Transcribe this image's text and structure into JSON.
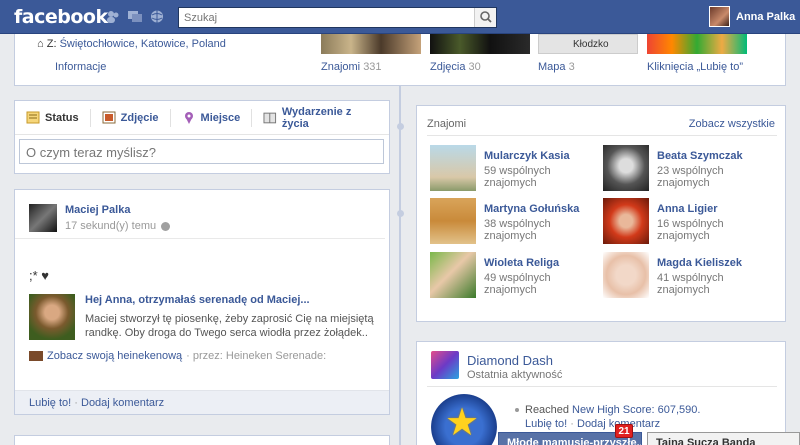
{
  "topbar": {
    "logo": "facebook",
    "search_placeholder": "Szukaj",
    "user_name": "Anna Palka"
  },
  "about": {
    "location_prefix": "Z:",
    "location": "Świętochłowice, Katowice, Poland",
    "info_label": "Informacje",
    "map_caption": "Kłodzko",
    "sections": [
      {
        "label": "Znajomi",
        "count": "331"
      },
      {
        "label": "Zdjęcia",
        "count": "30"
      },
      {
        "label": "Mapa",
        "count": "3"
      },
      {
        "label": "Kliknięcia „Lubię to”",
        "count": ""
      }
    ]
  },
  "composer": {
    "tabs": [
      "Status",
      "Zdjęcie",
      "Miejsce",
      "Wydarzenie z życia"
    ],
    "placeholder": "O czym teraz myślisz?"
  },
  "post": {
    "author": "Maciej Palka",
    "time": "17 sekund(y) temu",
    "message": ";* ♥",
    "attachment_title": "Hej Anna, otrzymałaś serenadę od Maciej...",
    "attachment_desc": "Maciej stworzył tę piosenkę, żeby zaprosić Cię na miejsiętą randkę. Oby droga do Twego serca wiodła przez żołądek..",
    "via_link": "Zobacz swoją heinekenową",
    "via_rest": "· przez: Heineken Serenade:",
    "like": "Lubię to!",
    "comment": "Dodaj komentarz"
  },
  "friends": {
    "title": "Znajomi",
    "see_all": "Zobacz wszystkie",
    "list": [
      {
        "name": "Mularczyk Kasia",
        "mutual": "59 wspólnych znajomych"
      },
      {
        "name": "Beata Szymczak",
        "mutual": "23 wspólnych znajomych"
      },
      {
        "name": "Martyna Gołuńska",
        "mutual": "38 wspólnych znajomych"
      },
      {
        "name": "Anna Ligier",
        "mutual": "16 wspólnych znajomych"
      },
      {
        "name": "Wioleta Religa",
        "mutual": "49 wspólnych znajomych"
      },
      {
        "name": "Magda Kieliszek",
        "mutual": "41 wspólnych znajomych"
      }
    ]
  },
  "game": {
    "name": "Diamond Dash",
    "subtitle": "Ostatnia aktywność",
    "reached": "Reached",
    "score_link": "New High Score: 607,590.",
    "like": "Lubię to!",
    "comment": "Dodaj komentarz"
  },
  "chat": {
    "tab1": "Młode mamusie-przyszłe...",
    "badge": "21",
    "tab2": "Tajna Sucza Banda"
  },
  "colors": {
    "brand": "#3b5998",
    "link": "#3b5998",
    "badge": "#e02020"
  }
}
